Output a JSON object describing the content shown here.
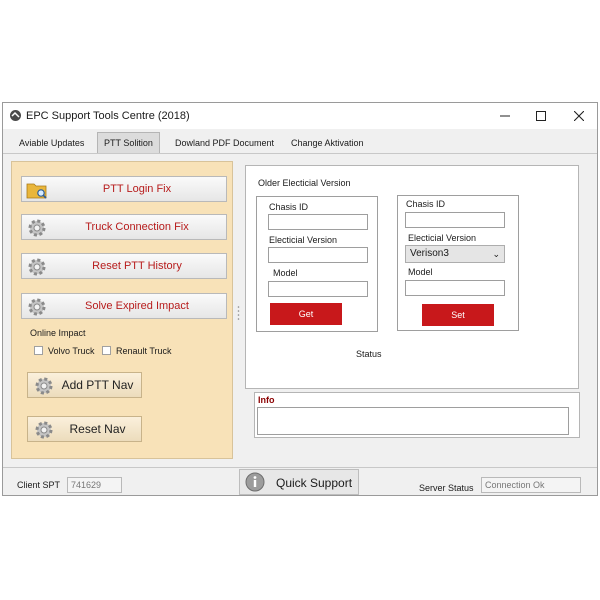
{
  "window": {
    "title": "EPC Support Tools Centre (2018)"
  },
  "tabs": [
    {
      "label": "Aviable Updates"
    },
    {
      "label": "PTT Solition"
    },
    {
      "label": "Dowland PDF Document"
    },
    {
      "label": "Change Aktivation"
    }
  ],
  "left_panel": {
    "buttons": [
      {
        "label": "PTT Login Fix",
        "icon": "folder-search-icon"
      },
      {
        "label": "Truck Connection Fix",
        "icon": "gear-icon"
      },
      {
        "label": "Reset PTT History",
        "icon": "gear-icon"
      },
      {
        "label": "Solve Expired Impact",
        "icon": "gear-icon"
      }
    ],
    "online_impact_label": "Online Impact",
    "checkboxes": [
      {
        "label": "Volvo Truck",
        "checked": false
      },
      {
        "label": "Renault Truck",
        "checked": false
      }
    ],
    "nav_buttons": [
      {
        "label": "Add PTT Nav",
        "icon": "gear-icon"
      },
      {
        "label": "Reset Nav",
        "icon": "gear-icon"
      }
    ]
  },
  "main": {
    "group_title": "Older Electicial Version",
    "left_form": {
      "chasis_label": "Chasis ID",
      "chasis_value": "",
      "version_label": "Electicial Version",
      "version_value": "",
      "model_label": "Model",
      "model_value": "",
      "button": "Get"
    },
    "right_form": {
      "chasis_label": "Chasis ID",
      "chasis_value": "",
      "version_label": "Electicial Version",
      "version_selected": "Verison3",
      "model_label": "Model",
      "model_value": "",
      "button": "Set"
    },
    "status_label": "Status"
  },
  "info": {
    "label": "Info",
    "value": ""
  },
  "footer": {
    "client_label": "Client SPT",
    "client_value": "741629",
    "quick_support": "Quick Support",
    "server_label": "Server Status",
    "server_value": "Connection Ok"
  },
  "colors": {
    "accent_red": "#c8181b",
    "panel_bg": "#f8e2b8",
    "button_text_red": "#b71c1c",
    "info_label": "#8b0000"
  }
}
